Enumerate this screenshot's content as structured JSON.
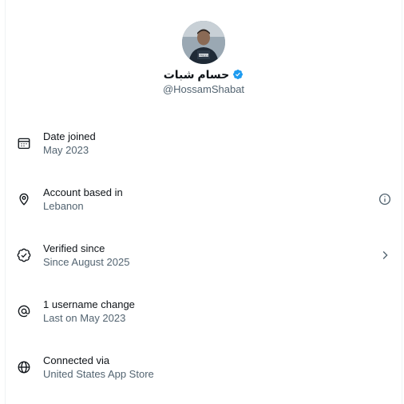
{
  "profile": {
    "display_name": "حسام شبات",
    "handle": "@HossamShabat",
    "avatar_icon": "profile-photo",
    "verified_color": "#1d9bf0"
  },
  "rows": [
    {
      "title": "Date joined",
      "subtitle": "May 2023",
      "icon": "calendar-icon",
      "trailing": null
    },
    {
      "title": "Account based in",
      "subtitle": "Lebanon",
      "icon": "location-pin-icon",
      "trailing": "info-icon"
    },
    {
      "title": "Verified since",
      "subtitle": "Since August 2025",
      "icon": "verified-badge-icon",
      "trailing": "chevron-right-icon"
    },
    {
      "title": "1 username change",
      "subtitle": "Last on May 2023",
      "icon": "at-sign-icon",
      "trailing": null
    },
    {
      "title": "Connected via",
      "subtitle": "United States App Store",
      "icon": "globe-icon",
      "trailing": null
    }
  ]
}
